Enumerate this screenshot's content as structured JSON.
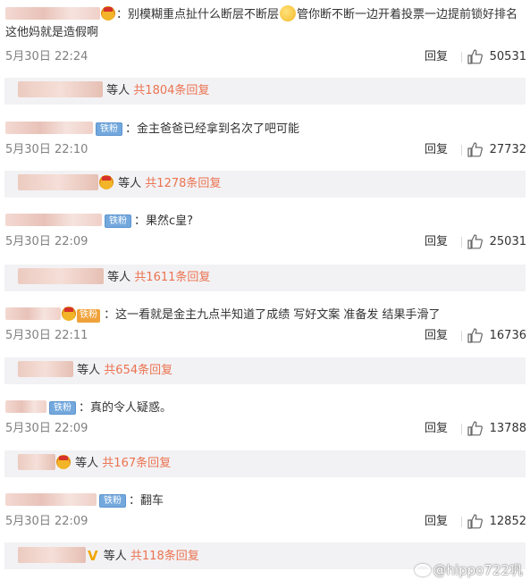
{
  "comments": [
    {
      "content": "：别模糊重点扯什么断层不断层",
      "content_cont": "管你断不断一边开着投票一边提前锁好排名这他妈就是造假啊",
      "time": "5月30日 22:24",
      "reply_label": "回复",
      "likes": "50531",
      "sub_prefix": "等人",
      "sub_total": "共1804条回复"
    },
    {
      "badge": "铁粉",
      "content": "：金主爸爸已经拿到名次了吧可能",
      "time": "5月30日 22:10",
      "reply_label": "回复",
      "likes": "27732",
      "sub_prefix": "等人",
      "sub_total": "共1278条回复"
    },
    {
      "badge": "铁粉",
      "content": "：果然c皇?",
      "time": "5月30日 22:09",
      "reply_label": "回复",
      "likes": "25031",
      "sub_prefix": "等人",
      "sub_total": "共1611条回复"
    },
    {
      "badge": "铁粉",
      "content": "：这一看就是金主九点半知道了成绩 写好文案 准备发 结果手滑了",
      "time": "5月30日 22:11",
      "reply_label": "回复",
      "likes": "16736",
      "sub_prefix": "等人",
      "sub_total": "共654条回复"
    },
    {
      "badge": "铁粉",
      "content": "：真的令人疑惑。",
      "time": "5月30日 22:09",
      "reply_label": "回复",
      "likes": "13788",
      "sub_prefix": "等人",
      "sub_total": "共167条回复"
    },
    {
      "badge": "铁粉",
      "content": "：翻车",
      "time": "5月30日 22:09",
      "reply_label": "回复",
      "likes": "12852",
      "sub_prefix": "等人",
      "sub_total": "共118条回复"
    }
  ],
  "watermark": "@hippo722巩",
  "colors": {
    "accent": "#eb7350",
    "fan_badge": "#73a8dd",
    "sub_bg": "#f2f2f5",
    "meta_text": "#808080"
  },
  "icons": {
    "like": "thumbs-up-icon",
    "crown": "crown-badge-icon",
    "emoji": "thinking-emoji-icon",
    "weibo": "weibo-logo-icon"
  }
}
